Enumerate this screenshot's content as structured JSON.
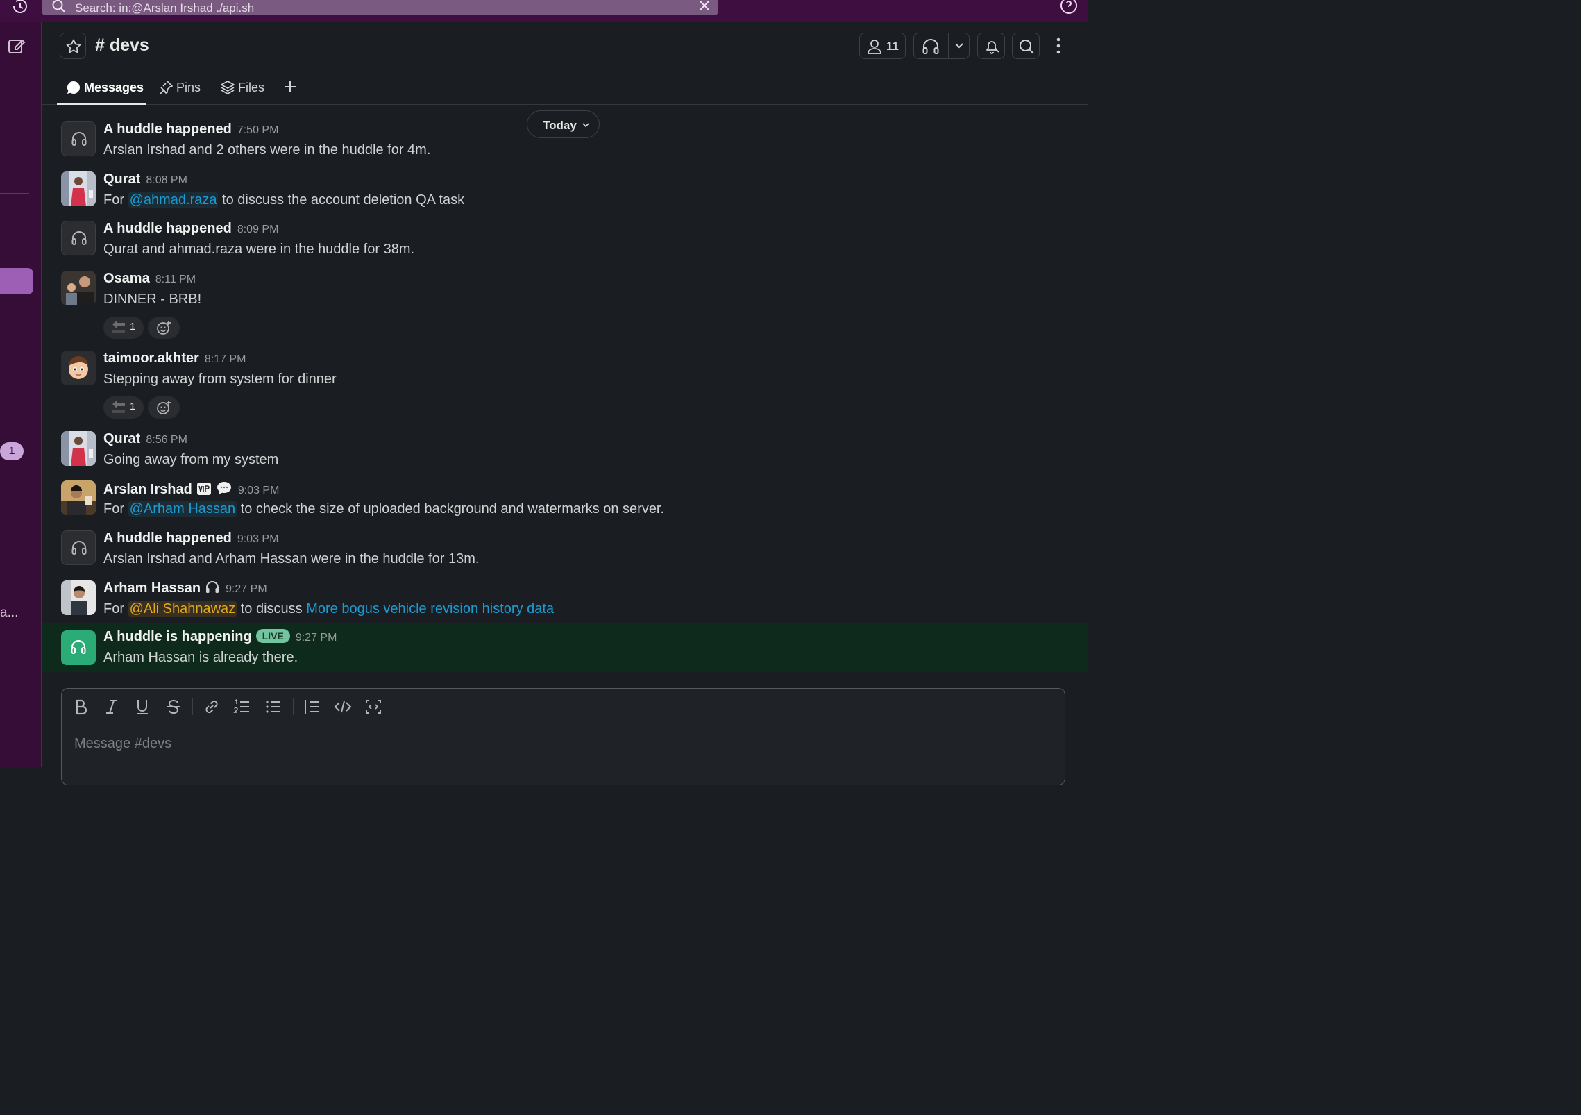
{
  "topbar": {
    "search_text": "Search: in:@Arslan Irshad ./api.sh"
  },
  "rail": {
    "badge_count": "1",
    "truncated_label": "a..."
  },
  "channel": {
    "name": "# devs",
    "member_count": "11"
  },
  "tabs": [
    {
      "label": "Messages",
      "icon": "message-bubble-icon"
    },
    {
      "label": "Pins",
      "icon": "pin-icon"
    },
    {
      "label": "Files",
      "icon": "layers-icon"
    }
  ],
  "date_divider": "Today",
  "messages": [
    {
      "name": "A huddle happened",
      "time": "7:50 PM",
      "body": "Arslan Irshad and 2 others were in the huddle for 4m."
    },
    {
      "name": "Qurat",
      "time": "8:08 PM",
      "pre": "For ",
      "mention": "@ahmad.raza",
      "post": " to discuss the account deletion QA task"
    },
    {
      "name": "A huddle happened",
      "time": "8:09 PM",
      "body": "Qurat and ahmad.raza were in the huddle for 38m."
    },
    {
      "name": "Osama",
      "time": "8:11 PM",
      "body": "DINNER - BRB!",
      "reaction_count": "1"
    },
    {
      "name": "taimoor.akhter",
      "time": "8:17 PM",
      "body": "Stepping away from system for dinner",
      "reaction_count": "1"
    },
    {
      "name": "Qurat",
      "time": "8:56 PM",
      "body": "Going away from my system"
    },
    {
      "name": "Arslan Irshad",
      "time": "9:03 PM",
      "pre": "For ",
      "mention": "@Arham Hassan",
      "post": " to check the size of uploaded background and watermarks on server."
    },
    {
      "name": "A huddle happened",
      "time": "9:03 PM",
      "body": "Arslan Irshad and Arham Hassan were in the huddle for 13m."
    },
    {
      "name": "Arham Hassan",
      "time": "9:27 PM",
      "pre": "For ",
      "mention": "@Ali Shahnawaz",
      "mid": " to discuss ",
      "link": "More bogus vehicle revision history data"
    },
    {
      "name": "A huddle is happening",
      "live": "LIVE",
      "time": "9:27 PM",
      "body": "Arham Hassan is already there."
    }
  ],
  "composer": {
    "placeholder": "Message #devs"
  },
  "colors": {
    "background": "#1a1d21",
    "workspace_purple": "#3f0e40",
    "mention_blue": "#1d9bd1",
    "mention_self": "#e8a81c",
    "live_green": "#2bac76"
  }
}
